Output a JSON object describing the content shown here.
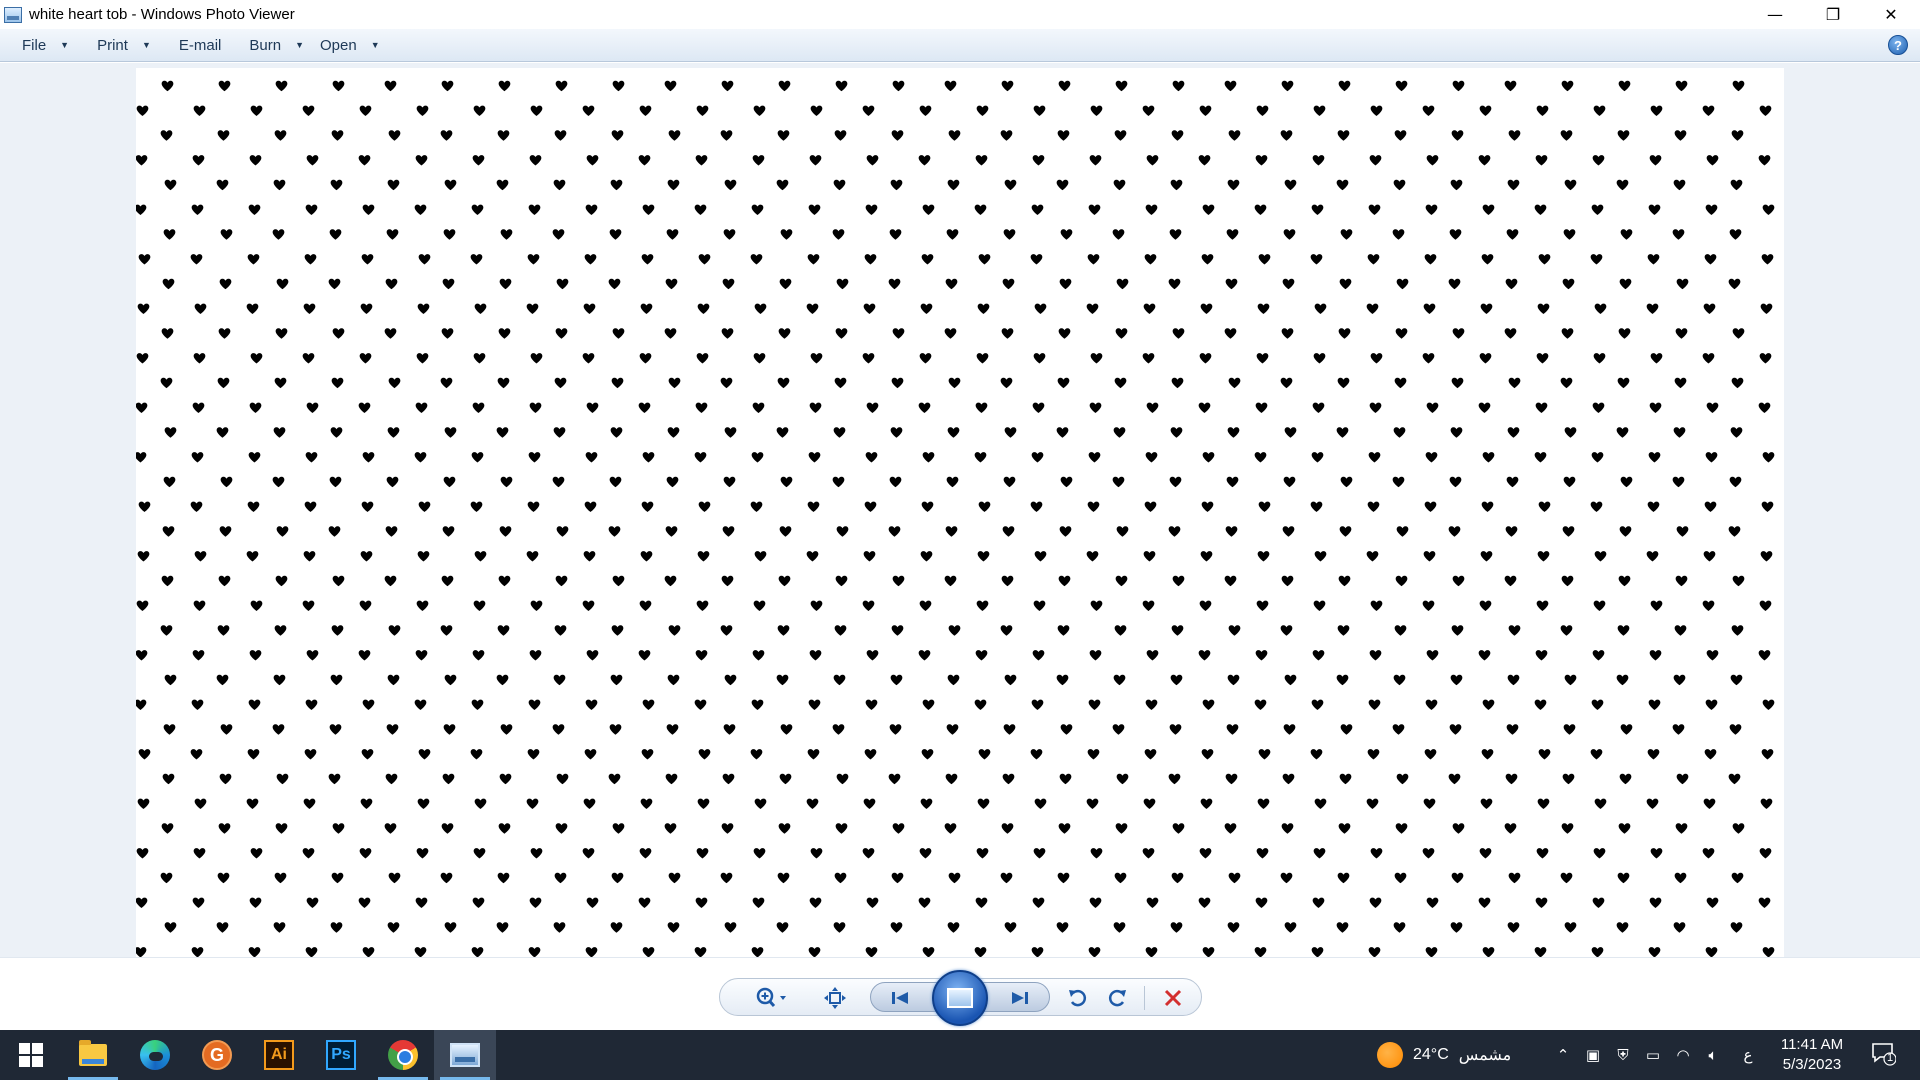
{
  "window": {
    "title": "white heart tob - Windows Photo Viewer",
    "controls": {
      "minimize": "—",
      "restore": "❐",
      "close": "✕"
    }
  },
  "menu": {
    "items": [
      {
        "label": "File",
        "has_dropdown": true
      },
      {
        "label": "Print",
        "has_dropdown": true
      },
      {
        "label": "E-mail",
        "has_dropdown": false
      },
      {
        "label": "Burn",
        "has_dropdown": true
      },
      {
        "label": "Open",
        "has_dropdown": true
      }
    ],
    "help": "?"
  },
  "photo": {
    "description_color": "#000000",
    "background": "#ffffff",
    "pattern_icon": "heart-icon"
  },
  "controls": {
    "zoom_icon": "zoom-icon",
    "fit_icon": "actual-size-icon",
    "prev_icon": "previous-icon",
    "slideshow_icon": "slideshow-icon",
    "next_icon": "next-icon",
    "rotate_ccw_icon": "rotate-counterclockwise-icon",
    "rotate_cw_icon": "rotate-clockwise-icon",
    "delete_icon": "delete-icon"
  },
  "taskbar": {
    "apps": [
      "start-icon",
      "file-explorer-icon",
      "edge-icon",
      "grammarly-icon",
      "illustrator-icon",
      "photoshop-icon",
      "chrome-icon",
      "photo-viewer-icon"
    ],
    "grammarly_letter": "G",
    "illustrator_label": "Ai",
    "photoshop_label": "Ps",
    "weather_temp": "24°C",
    "weather_text": "مشمس",
    "language": "ع",
    "time": "11:41 AM",
    "date": "5/3/2023",
    "notification_count": "1"
  },
  "colors": {
    "menubar": "#dde8f4",
    "taskbar": "#1f2835",
    "accent": "#1e5aa8",
    "delete": "#d32f2f"
  }
}
